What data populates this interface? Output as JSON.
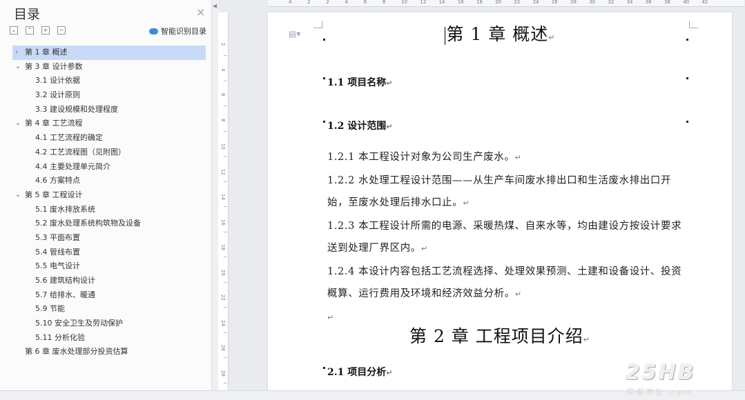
{
  "sidebar": {
    "title": "目录",
    "close": "×",
    "toolbar": {
      "collapse_all": "⌄",
      "expand_up": "⌃",
      "add": "+",
      "remove": "−"
    },
    "smart_toc_label": "智能识别目录",
    "items": [
      {
        "label": "第 1 章   概述",
        "level": 1,
        "arrow": "›",
        "active": true
      },
      {
        "label": "第 3 章   设计参数",
        "level": 1,
        "arrow": "⌄",
        "active": false
      },
      {
        "label": "3.1 设计依据",
        "level": 2,
        "arrow": "",
        "active": false
      },
      {
        "label": "3.2 设计原则",
        "level": 2,
        "arrow": "",
        "active": false
      },
      {
        "label": "3.3 建设规模和处理程度",
        "level": 2,
        "arrow": "",
        "active": false
      },
      {
        "label": "第 4 章   工艺流程",
        "level": 1,
        "arrow": "⌄",
        "active": false
      },
      {
        "label": "4.1 工艺流程的确定",
        "level": 2,
        "arrow": "",
        "active": false
      },
      {
        "label": "4.2 工艺流程图（见附图）",
        "level": 2,
        "arrow": "",
        "active": false
      },
      {
        "label": "4.4 主要处理单元简介",
        "level": 2,
        "arrow": "",
        "active": false
      },
      {
        "label": "4.6 方案特点",
        "level": 2,
        "arrow": "",
        "active": false
      },
      {
        "label": "第 5 章  工程设计",
        "level": 1,
        "arrow": "⌄",
        "active": false
      },
      {
        "label": "5.1 废水排放系统",
        "level": 2,
        "arrow": "",
        "active": false
      },
      {
        "label": "5.2 废水处理系统构筑物及设备",
        "level": 2,
        "arrow": "",
        "active": false
      },
      {
        "label": "5.3 平面布置",
        "level": 2,
        "arrow": "",
        "active": false
      },
      {
        "label": "5.4 管线布置",
        "level": 2,
        "arrow": "",
        "active": false
      },
      {
        "label": "5.5 电气设计",
        "level": 2,
        "arrow": "",
        "active": false
      },
      {
        "label": "5.6 建筑结构设计",
        "level": 2,
        "arrow": "",
        "active": false
      },
      {
        "label": "5.7 给排水、暖通",
        "level": 2,
        "arrow": "",
        "active": false
      },
      {
        "label": "5.9 节能",
        "level": 2,
        "arrow": "",
        "active": false
      },
      {
        "label": "5.10 安全卫生及劳动保护",
        "level": 2,
        "arrow": "",
        "active": false
      },
      {
        "label": "5.11 分析化验",
        "level": 2,
        "arrow": "",
        "active": false
      },
      {
        "label": "第 6 章  废水处理部分投资估算",
        "level": 1,
        "arrow": "",
        "active": false
      }
    ]
  },
  "ruler": {
    "horizontal": [
      "4",
      "2",
      "2",
      "4",
      "6",
      "8",
      "10",
      "12",
      "14",
      "16",
      "18",
      "20",
      "22",
      "24",
      "26",
      "28",
      "30",
      "32",
      "34",
      "36",
      "38",
      "40",
      "42"
    ],
    "vertical": [
      "2",
      "4",
      "6",
      "8",
      "10",
      "12",
      "14",
      "16",
      "18",
      "20",
      "22",
      "24",
      "26",
      "28"
    ]
  },
  "document": {
    "chapter1": "第 1 章   概述",
    "sec_1_1": "1.1 项目名称",
    "sec_1_2": "1.2 设计范围",
    "p1": "1.2.1 本工程设计对象为公司生产废水。",
    "p2": "1.2.2 水处理工程设计范围——从生产车间废水排出口和生活废水排出口开始，至废水处理后排水口止。",
    "p3": "1.2.3 本工程设计所需的电源、采暖热煤、自来水等，均由建设方按设计要求送到处理厂界区内。",
    "p4": "1.2.4 本设计内容包括工艺流程选择、处理效果预测、土建和设备设计、投资概算、运行费用及环境和经济效益分析。",
    "chapter2": "第 2 章   工程项目介绍",
    "sec_2_1": "2.1 项目分析",
    "para_mark": "↵"
  },
  "watermark": {
    "logo": "25HB",
    "text": "环保学社·com"
  }
}
